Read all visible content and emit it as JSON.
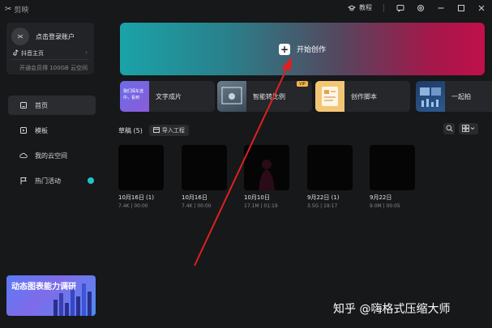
{
  "titlebar": {
    "app_name": "剪映",
    "tutorial_label": "教程"
  },
  "sidebar": {
    "login_label": "点击登录账户",
    "douyin_label": "抖音主页",
    "vip_label": "开通会员得 100GB 云空间",
    "nav": [
      {
        "label": "首页",
        "icon": "home-icon",
        "active": true
      },
      {
        "label": "模板",
        "icon": "template-icon",
        "active": false
      },
      {
        "label": "我的云空间",
        "icon": "cloud-icon",
        "active": false
      },
      {
        "label": "热门活动",
        "icon": "flag-icon",
        "active": false
      }
    ],
    "promo_text": "动态图表能力调研"
  },
  "hero": {
    "label": "开始创作",
    "gradient_start": "#1aa3a8",
    "gradient_end": "#c0104a"
  },
  "tools": [
    {
      "label": "文字成片",
      "thumb_text": "我们探车途中，看到"
    },
    {
      "label": "智能转比例",
      "badge": "VIP"
    },
    {
      "label": "创作脚本"
    },
    {
      "label": "一起拍"
    }
  ],
  "drafts": {
    "title": "草稿",
    "count": "(5)",
    "import_label": "导入工程",
    "items": [
      {
        "title": "10月16日 (1)",
        "meta": "7.4K | 00:00"
      },
      {
        "title": "10月16日",
        "meta": "7.4K | 00:00"
      },
      {
        "title": "10月10日",
        "meta": "17.1M | 01:19"
      },
      {
        "title": "9月22日 (1)",
        "meta": "3.5G | 19:17"
      },
      {
        "title": "9月22日",
        "meta": "9.0M | 00:05"
      }
    ]
  },
  "watermark": "知乎 @嗨格式压缩大师",
  "colors": {
    "accent": "#1fc5c9",
    "arrow": "#e02020",
    "background": "#17181a"
  }
}
